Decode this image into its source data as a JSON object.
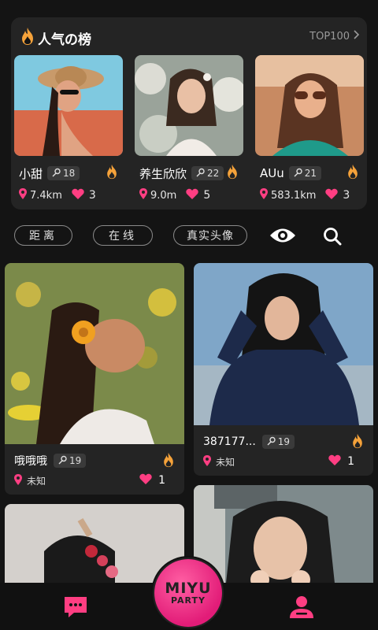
{
  "ranking": {
    "title": "人气の榜",
    "more_label": "TOP100",
    "items": [
      {
        "name": "小甜",
        "level": "18",
        "distance": "7.4km",
        "likes": "3"
      },
      {
        "name": "养生欣欣",
        "level": "22",
        "distance": "9.0m",
        "likes": "5"
      },
      {
        "name": "AUu",
        "level": "21",
        "distance": "583.1km",
        "likes": "3"
      }
    ]
  },
  "filters": {
    "distance": "距离",
    "online": "在线",
    "real_avatar": "真实头像"
  },
  "feed": [
    {
      "name": "哦哦哦",
      "level": "19",
      "location": "未知",
      "likes": "1"
    },
    {
      "name": "387177...",
      "level": "19",
      "location": "未知",
      "likes": "1"
    }
  ],
  "center_button": {
    "line1": "MIYU",
    "line2": "PARTY"
  },
  "colors": {
    "accent": "#ff3e82",
    "fire": "#f5a23a",
    "background": "#141414",
    "card": "#242424"
  },
  "icons": [
    "fire-icon",
    "chevron-right-icon",
    "level-icon",
    "location-pin-icon",
    "heart-icon",
    "eye-icon",
    "search-icon",
    "message-icon",
    "user-icon"
  ]
}
